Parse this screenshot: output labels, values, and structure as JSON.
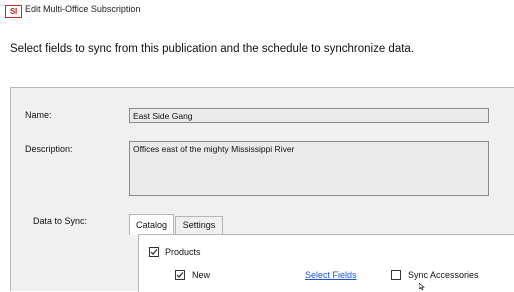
{
  "window": {
    "icon_text": "SI",
    "title": "Edit Multi-Office Subscription"
  },
  "instructions": "Select fields to sync from this publication and the schedule to synchronize data.",
  "form": {
    "name_label": "Name:",
    "name_value": "East Side Gang",
    "description_label": "Description:",
    "description_value": "Offices east of the mighty Mississippi River",
    "data_to_sync_label": "Data to Sync:"
  },
  "tabs": [
    {
      "label": "Catalog",
      "active": true
    },
    {
      "label": "Settings",
      "active": false
    }
  ],
  "catalog": {
    "products_label": "Products",
    "products_checked": true,
    "new_label": "New",
    "new_checked": true,
    "select_fields_link": "Select Fields",
    "sync_accessories_label": "Sync Accessories",
    "sync_accessories_checked": false
  },
  "colors": {
    "app_icon": "#c62828",
    "panel_bg": "#f0f0f0",
    "link": "#1a56d6"
  }
}
